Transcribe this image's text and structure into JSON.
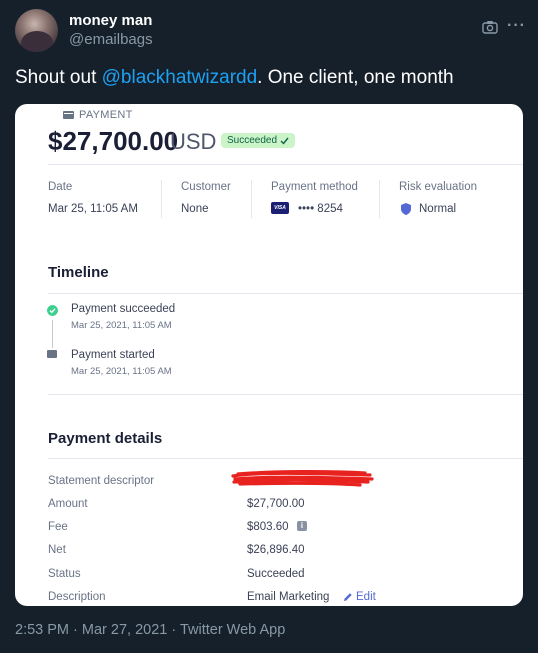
{
  "tweet": {
    "display_name": "money man",
    "handle": "@emailbags",
    "text_before": "Shout out ",
    "mention": "@blackhatwizardd",
    "text_after": ". One client, one month",
    "timestamp": "2:53 PM · Mar 27, 2021 · Twitter Web App",
    "icons": {
      "camera": "camera-icon",
      "more": "more-icon"
    }
  },
  "payment": {
    "label": "PAYMENT",
    "amount": "$27,700.00",
    "currency": "USD",
    "status_badge": "Succeeded",
    "meta": {
      "date_label": "Date",
      "date_value": "Mar 25, 11:05 AM",
      "customer_label": "Customer",
      "customer_value": "None",
      "method_label": "Payment method",
      "card_brand": "VISA",
      "card_value": "•••• 8254",
      "risk_label": "Risk evaluation",
      "risk_value": "Normal"
    },
    "timeline": {
      "heading": "Timeline",
      "events": [
        {
          "title": "Payment succeeded",
          "date": "Mar 25, 2021, 11:05 AM"
        },
        {
          "title": "Payment started",
          "date": "Mar 25, 2021, 11:05 AM"
        }
      ]
    },
    "details": {
      "heading": "Payment details",
      "rows": [
        {
          "label": "Statement descriptor",
          "value": ""
        },
        {
          "label": "Amount",
          "value": "$27,700.00"
        },
        {
          "label": "Fee",
          "value": "$803.60"
        },
        {
          "label": "Net",
          "value": "$26,896.40"
        },
        {
          "label": "Status",
          "value": "Succeeded"
        },
        {
          "label": "Description",
          "value": "Email Marketing"
        }
      ],
      "edit_label": "Edit"
    }
  },
  "colors": {
    "background": "#15202b",
    "mention": "#1da1f2",
    "badge_bg": "#cbf4c9",
    "badge_text": "#0e6245",
    "link": "#5469d4",
    "redaction": "#e8231f"
  }
}
